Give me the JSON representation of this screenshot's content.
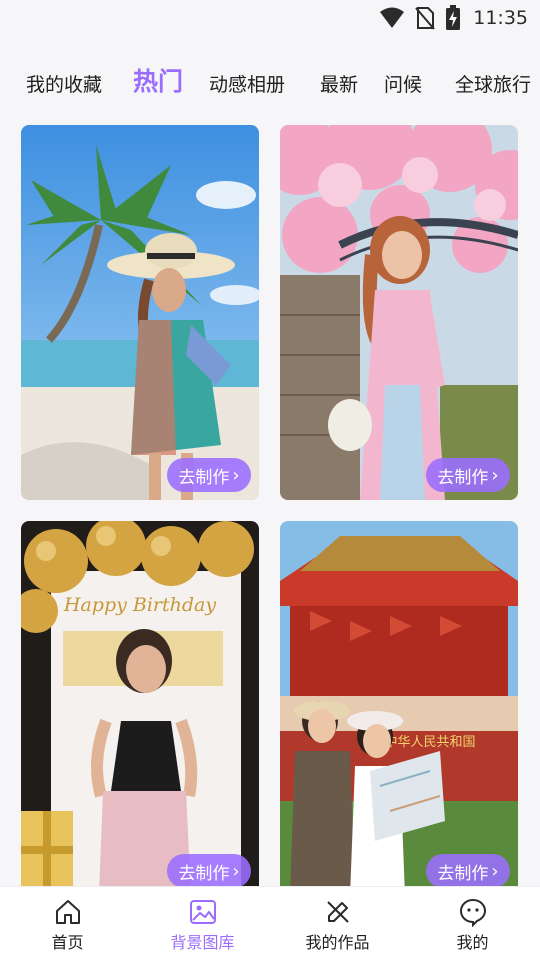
{
  "status_bar": {
    "time": "11:35",
    "icons": [
      "wifi-icon",
      "no-sim-icon",
      "battery-charging-icon"
    ]
  },
  "top_tabs": [
    {
      "label": "我的收藏",
      "active": false
    },
    {
      "label": "热门",
      "active": true
    },
    {
      "label": "动感相册",
      "active": false
    },
    {
      "label": "最新",
      "active": false
    },
    {
      "label": "问候",
      "active": false
    },
    {
      "label": "全球旅行",
      "active": false
    }
  ],
  "cards": [
    {
      "theme": "tropical beach with palm tree",
      "action_label": "去制作"
    },
    {
      "theme": "cherry blossoms and bridge",
      "action_label": "去制作"
    },
    {
      "theme": "birthday balloons frame",
      "overlay_text": "Happy Birthday",
      "action_label": "去制作"
    },
    {
      "theme": "traditional gate with flags",
      "banner_text": "中华人民共和国",
      "action_label": "去制作"
    }
  ],
  "bottom_nav": [
    {
      "label": "首页",
      "icon": "home-icon",
      "active": false
    },
    {
      "label": "背景图库",
      "icon": "image-gallery-icon",
      "active": true
    },
    {
      "label": "我的作品",
      "icon": "edit-work-icon",
      "active": false
    },
    {
      "label": "我的",
      "icon": "profile-chat-icon",
      "active": false
    }
  ],
  "colors": {
    "accent": "#9b6dff",
    "text": "#1f1f1f",
    "background": "#f6f6f8"
  }
}
